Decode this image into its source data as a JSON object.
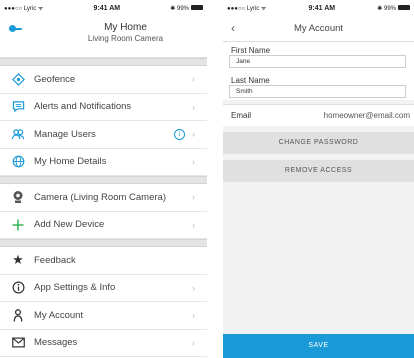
{
  "left": {
    "status": {
      "carrier": "●●●○○ Lyric ᯤ",
      "time": "9:41 AM",
      "battery": "✱ 99%"
    },
    "header": {
      "title": "My Home",
      "subtitle": "Living Room Camera"
    },
    "group1": [
      {
        "label": "Geofence",
        "icon": "geofence-icon"
      },
      {
        "label": "Alerts and Notifications",
        "icon": "chat-icon"
      },
      {
        "label": "Manage Users",
        "icon": "users-icon"
      },
      {
        "label": "My Home Details",
        "icon": "globe-icon"
      }
    ],
    "group2": [
      {
        "label": "Camera (Living Room Camera)",
        "icon": "camera-icon"
      },
      {
        "label": "Add New Device",
        "icon": "plus-icon"
      }
    ],
    "group3": [
      {
        "label": "Feedback",
        "icon": "star-icon"
      },
      {
        "label": "App Settings & Info",
        "icon": "info-icon"
      },
      {
        "label": "My Account",
        "icon": "person-icon"
      },
      {
        "label": "Messages",
        "icon": "envelope-icon"
      }
    ],
    "info_badge": "i",
    "chevron": "›"
  },
  "right": {
    "status": {
      "carrier": "●●●○○ Lyric ᯤ",
      "time": "9:41 AM",
      "battery": "✱ 99%"
    },
    "header": {
      "back": "‹",
      "title": "My Account"
    },
    "first_name_label": "First Name",
    "first_name_value": "Jane",
    "last_name_label": "Last Name",
    "last_name_value": "Smith",
    "email_label": "Email",
    "email_value": "homeowner@email.com",
    "change_password": "CHANGE PASSWORD",
    "remove_access": "REMOVE ACCESS",
    "save": "SAVE"
  },
  "colors": {
    "accent": "#1a9ad6",
    "divider": "#e4e4e4"
  }
}
